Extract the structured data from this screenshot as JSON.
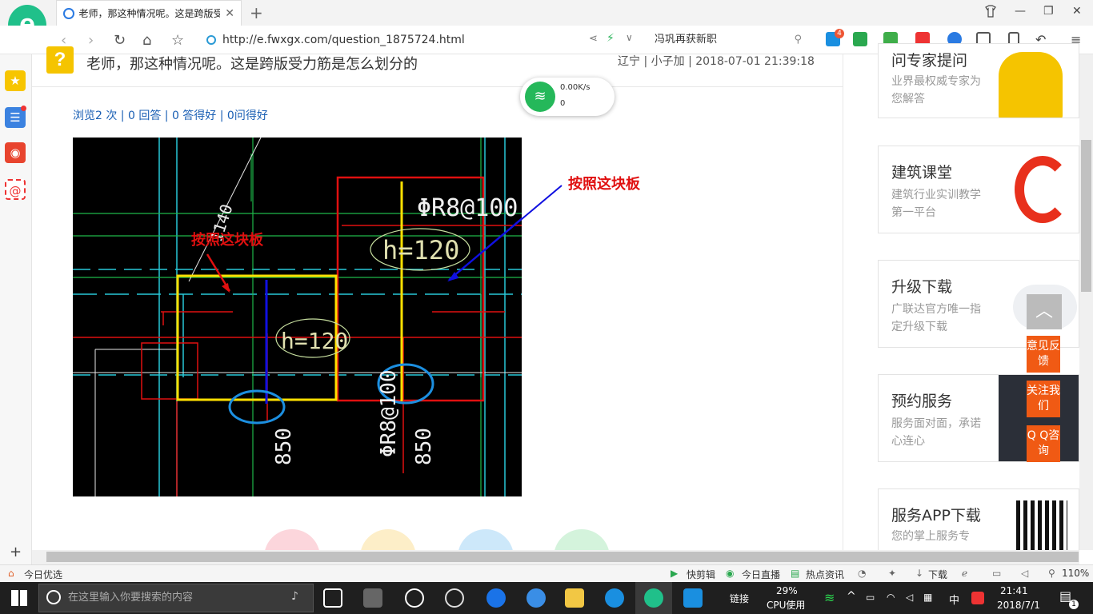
{
  "browser": {
    "logo_letter": "e",
    "tab_title": "老师，那这种情况呢。这是跨版受",
    "tab_close": "✕",
    "new_tab": "+",
    "url": "http://e.fwxgx.com/question_1875724.html",
    "search_text": "冯巩再获新职",
    "badge_count": "4"
  },
  "question": {
    "icon": "?",
    "title": "老师，那这种情况呢。这是跨版受力筋是怎么划分的",
    "meta": "辽宁 | 小子加 | 2018-07-01 21:39:18",
    "stats": "浏览2 次 | 0 回答 | 0 答得好 | 0问得好"
  },
  "cad": {
    "label_red": "按照这块板",
    "label_blue": "按照这块板",
    "rebar_top": "ΦR8@100",
    "rebar_vertical": "ΦR8@100",
    "slab_thickness_1": "h=120",
    "slab_thickness_2": "h=120",
    "dim_1": "850",
    "dim_2": "850",
    "dim_diag": "1140"
  },
  "network_widget": {
    "speed": "0.00K/s",
    "count": "0"
  },
  "sidebar": {
    "cards": [
      {
        "title": "问专家提问",
        "sub": "业界最权威专家为您解答"
      },
      {
        "title": "建筑课堂",
        "sub": "建筑行业实训教学第一平台"
      },
      {
        "title": "升级下载",
        "sub": "广联达官方唯一指定升级下载"
      },
      {
        "title": "预约服务",
        "sub": "服务面对面，承诺心连心"
      },
      {
        "title": "服务APP下载",
        "sub": "您的掌上服务专"
      }
    ],
    "float_buttons": [
      "意见反馈",
      "关注我们",
      "Q Q咨询"
    ],
    "to_top": "︿"
  },
  "statusbar": {
    "left": "今日优选",
    "items": [
      "快剪辑",
      "今日直播",
      "热点资讯",
      "下载"
    ],
    "zoom": "110%"
  },
  "taskbar": {
    "search_placeholder": "在这里输入你要搜索的内容",
    "link_label": "链接",
    "cpu_percent": "29%",
    "cpu_label": "CPU使用",
    "ime": "中",
    "time": "21:41",
    "date": "2018/7/1",
    "notification_count": "1"
  },
  "colors": {
    "brand_green": "#20c08a",
    "link_blue": "#1a5fb4",
    "orange": "#f05a14",
    "cad_red": "#e01010",
    "cad_yellow": "#ffe000",
    "cad_blue": "#1010e0",
    "cad_cyan": "#29c8d8"
  }
}
